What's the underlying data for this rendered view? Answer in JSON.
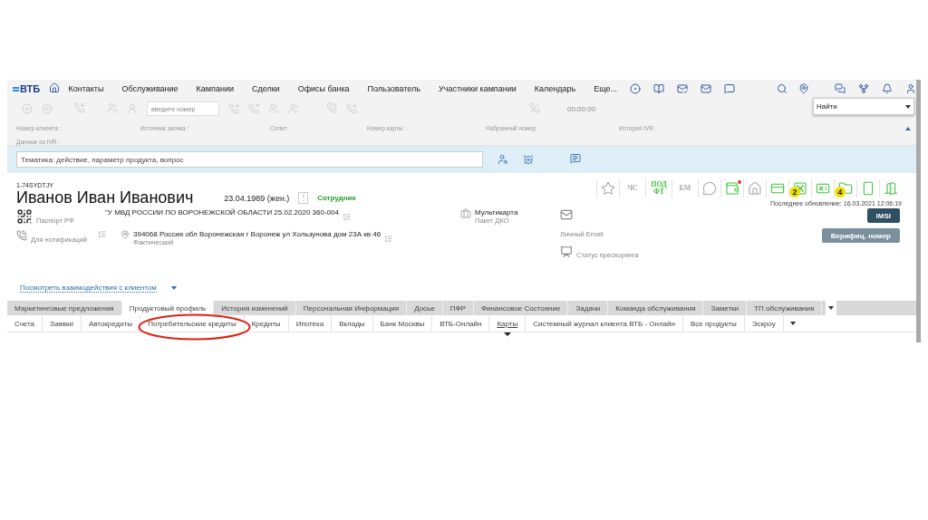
{
  "nav": {
    "logo": "ВТБ",
    "items": [
      "Контакты",
      "Обслуживание",
      "Кампании",
      "Сделки",
      "Офисы банка",
      "Пользователь",
      "Участники кампании",
      "Календарь",
      "Еще..."
    ]
  },
  "call_toolbar": {
    "number_placeholder": "введите номер",
    "timer": "00:00:00"
  },
  "search_select": {
    "value": "Найти"
  },
  "call_info": {
    "expanded": true,
    "fields": [
      "Номер клиента :",
      "Источник звонка :",
      "Сплит :",
      "Номер карты :",
      "Набранный номер :",
      "История IVR :"
    ],
    "ivr_label": "Данные из IVR :"
  },
  "topic": {
    "placeholder": "Тематика: действие, параметр продукта, вопрос"
  },
  "client": {
    "id": "1-74SYDTJY",
    "name": "Иванов Иван Иванович",
    "birth": "23.04.1989 (жен.)",
    "warning": "!",
    "status": "Сотрудник",
    "document": {
      "text": "\"У МВД РОССИИ ПО ВОРОНЕЖСКОЙ ОБЛАСТИ 25.02.2020 360-004",
      "type": "Паспорт РФ"
    },
    "phone_label": "Для нотификаций",
    "address": {
      "text": "394068 Россия обл Воронежская г Воронеж ул Хользунова дом 23А кв 46",
      "type": "Фактический"
    },
    "package": {
      "name": "Мультикарта",
      "type": "Пакет ДКО"
    },
    "email_label": "Личный Email",
    "prescoring_label": "Статус прескоринга",
    "interactions_link": "Посмотреть взаимодействия с клиентом"
  },
  "badges": [
    {
      "kind": "star",
      "active": false,
      "alert": false
    },
    {
      "kind": "text",
      "label": "ЧС",
      "active": false,
      "alert": false
    },
    {
      "kind": "text",
      "label": "ПОД ФТ",
      "active": true,
      "alert": false
    },
    {
      "kind": "text",
      "label": "БМ",
      "active": false,
      "alert": false
    },
    {
      "kind": "chat",
      "active": false,
      "alert": false
    },
    {
      "kind": "wallet",
      "active": true,
      "alert": true
    },
    {
      "kind": "house",
      "active": false,
      "alert": false
    },
    {
      "kind": "card",
      "active": true,
      "alert": false
    },
    {
      "kind": "safe",
      "active": true,
      "alert": false,
      "count": "2"
    },
    {
      "kind": "id-card",
      "active": true,
      "alert": false
    },
    {
      "kind": "folder",
      "active": true,
      "alert": false,
      "count": "4"
    },
    {
      "kind": "phone",
      "active": true,
      "alert": false
    },
    {
      "kind": "door",
      "active": true,
      "alert": false
    }
  ],
  "last_update": "Последнее обновление: 16.03.2021 12:06:19",
  "buttons": [
    {
      "label": "IMSI",
      "kind": "primary"
    },
    {
      "label": "Верифиц. номер",
      "kind": "secondary"
    }
  ],
  "tabs": [
    {
      "label": "Маркетинговые предложения",
      "selected": false
    },
    {
      "label": "Продуктовый профиль",
      "selected": true
    },
    {
      "label": "История изменений",
      "selected": false
    },
    {
      "label": "Персональная Информация",
      "selected": false
    },
    {
      "label": "Досье",
      "selected": false
    },
    {
      "label": "ПФР",
      "selected": false
    },
    {
      "label": "Финансовое Состояние",
      "selected": false
    },
    {
      "label": "Задачи",
      "selected": false
    },
    {
      "label": "Команда обслуживания",
      "selected": false
    },
    {
      "label": "Заметки",
      "selected": false
    },
    {
      "label": "ТП обслуживания",
      "selected": false
    }
  ],
  "subtabs": [
    {
      "label": "Счета",
      "selected": false
    },
    {
      "label": "Заявки",
      "selected": false
    },
    {
      "label": "Автокредиты",
      "selected": false
    },
    {
      "label": "Потребительские кредиты",
      "selected": false,
      "circled": true
    },
    {
      "label": "Кредиты",
      "selected": false
    },
    {
      "label": "Ипотека",
      "selected": false
    },
    {
      "label": "Вклады",
      "selected": false
    },
    {
      "label": "Банк Москвы",
      "selected": false
    },
    {
      "label": "ВТБ-Онлайн",
      "selected": false
    },
    {
      "label": "Карты",
      "selected": true
    },
    {
      "label": "Системный журнал клиента ВТБ - Онлайн",
      "selected": false
    },
    {
      "label": "Все продукты",
      "selected": false
    },
    {
      "label": "Эскроу",
      "selected": false
    }
  ]
}
